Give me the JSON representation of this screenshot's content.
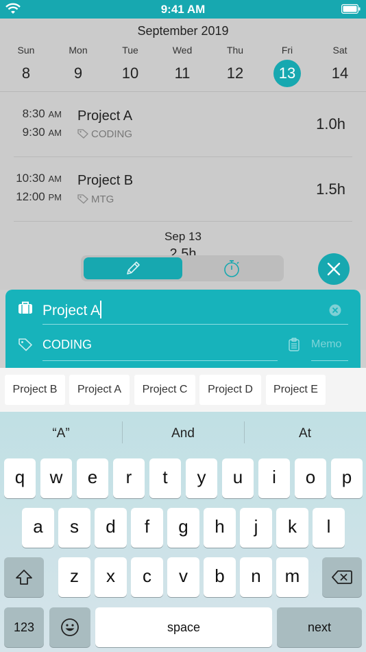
{
  "status": {
    "time": "9:41 AM"
  },
  "calendar": {
    "month": "September 2019",
    "days": [
      {
        "name": "Sun",
        "date": "8"
      },
      {
        "name": "Mon",
        "date": "9"
      },
      {
        "name": "Tue",
        "date": "10"
      },
      {
        "name": "Wed",
        "date": "11"
      },
      {
        "name": "Thu",
        "date": "12"
      },
      {
        "name": "Fri",
        "date": "13"
      },
      {
        "name": "Sat",
        "date": "14"
      }
    ],
    "selected_date": "13"
  },
  "entries": [
    {
      "start": "8:30",
      "start_ampm": "AM",
      "end": "9:30",
      "end_ampm": "AM",
      "project": "Project A",
      "tag": "CODING",
      "duration": "1.0h"
    },
    {
      "start": "10:30",
      "start_ampm": "AM",
      "end": "12:00",
      "end_ampm": "PM",
      "project": "Project B",
      "tag": "MTG",
      "duration": "1.5h"
    }
  ],
  "summary": {
    "date": "Sep 13",
    "total": "2.5h"
  },
  "form": {
    "project_value": "Project A",
    "tag_value": "CODING",
    "memo_placeholder": "Memo"
  },
  "suggestions": [
    "Project B",
    "Project A",
    "Project C",
    "Project D",
    "Project E"
  ],
  "keyboard": {
    "predictions": [
      "“A”",
      "And",
      "At"
    ],
    "row1": [
      "q",
      "w",
      "e",
      "r",
      "t",
      "y",
      "u",
      "i",
      "o",
      "p"
    ],
    "row2": [
      "a",
      "s",
      "d",
      "f",
      "g",
      "h",
      "j",
      "k",
      "l"
    ],
    "row3": [
      "z",
      "x",
      "c",
      "v",
      "b",
      "n",
      "m"
    ],
    "numbers_label": "123",
    "space_label": "space",
    "next_label": "next"
  },
  "colors": {
    "accent": "#17a8b0"
  }
}
